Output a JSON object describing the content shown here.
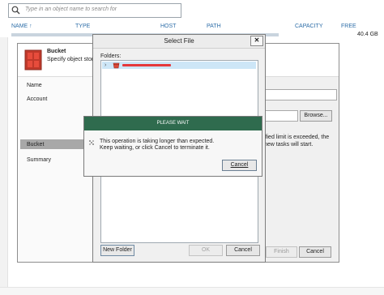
{
  "search": {
    "placeholder": "Type in an object name to search for"
  },
  "columns": [
    {
      "label": "NAME ↑"
    },
    {
      "label": "TYPE"
    },
    {
      "label": "HOST"
    },
    {
      "label": "PATH"
    },
    {
      "label": "CAPACITY"
    },
    {
      "label": "FREE"
    }
  ],
  "row": {
    "free": "40.4 GB"
  },
  "wizard": {
    "title": "Bucket",
    "subtitle": "Specify object stora",
    "nav": [
      "Name",
      "Account",
      "Bucket",
      "Summary"
    ],
    "active_step": "Bucket",
    "browse_label": "Browse...",
    "limit_text": "ified limit is exceeded, the new tasks will start.",
    "finish_label": "Finish",
    "cancel_label": "Cancel"
  },
  "select_file": {
    "title": "Select File",
    "close_label": "✕",
    "folders_label": "Folders:",
    "tree_toggle": "›",
    "new_folder_label": "New Folder",
    "ok_label": "OK",
    "cancel_label": "Cancel"
  },
  "please_wait": {
    "title": "PLEASE WAIT",
    "message_line1": "This operation is taking longer than expected.",
    "message_line2": "Keep waiting, or click Cancel to terminate it.",
    "cancel_label": "Cancel"
  },
  "colors": {
    "accent_green": "#2f6b4e",
    "header_blue": "#2e6ea8",
    "redacted": "#e5383b"
  }
}
